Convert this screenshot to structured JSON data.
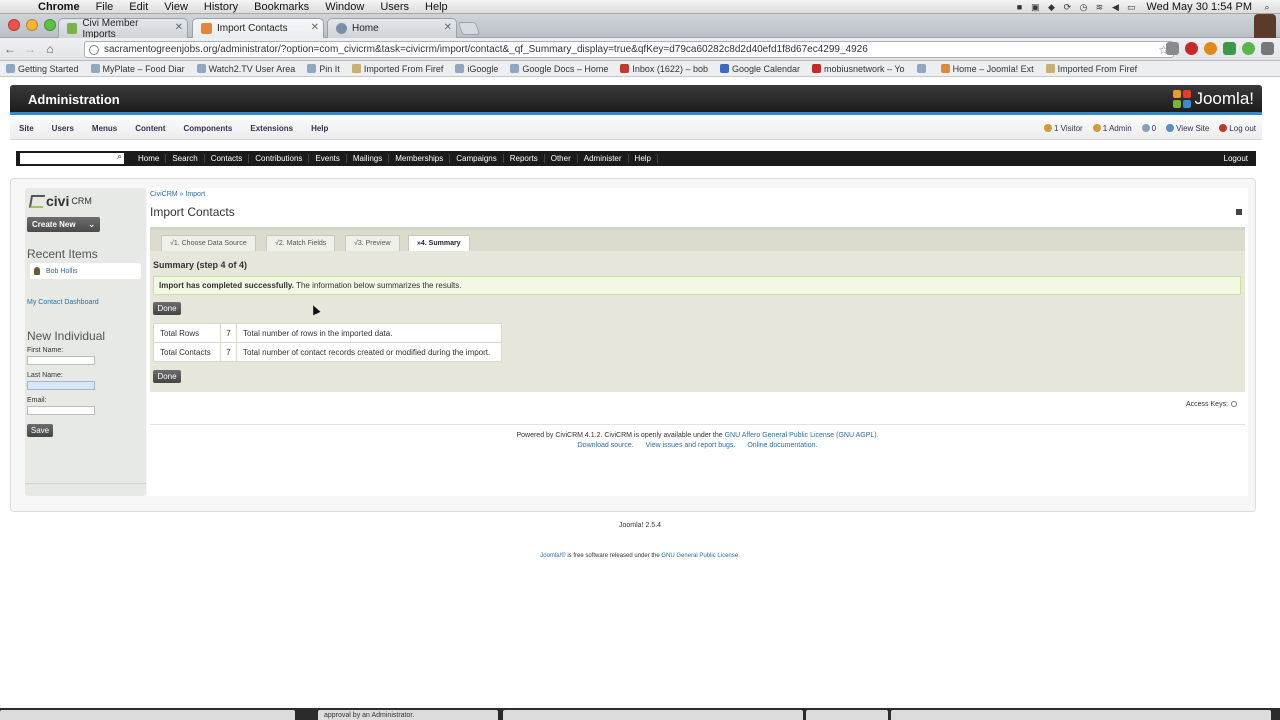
{
  "menubar": {
    "app": "Chrome",
    "items": [
      "File",
      "Edit",
      "View",
      "History",
      "Bookmarks",
      "Window",
      "Users",
      "Help"
    ],
    "clock": "Wed May 30  1:54 PM"
  },
  "tabs": [
    {
      "label": "Civi Member Imports",
      "color": "#7ab24a"
    },
    {
      "label": "Import Contacts",
      "color": "#e2873a"
    },
    {
      "label": "Home",
      "color": "#7a8fa5"
    }
  ],
  "address": {
    "url": "sacramentogreenjobs.org/administrator/?option=com_civicrm&task=civicrm/import/contact&_qf_Summary_display=true&qfKey=d79ca60282c8d2d40efd1f8d67ec4299_4926"
  },
  "bookmarks": [
    "Getting Started",
    "MyPlate – Food Diar",
    "Watch2.TV User Area",
    "Pin It",
    "Imported From Firef",
    "iGoogle",
    "Google Docs – Home",
    "Inbox (1622) – bob",
    "Google Calendar",
    "mobiusnetwork – Yo",
    "",
    "Home – Joomla! Ext",
    "Imported From Firef"
  ],
  "admin": {
    "title": "Administration",
    "logo": "Joomla!"
  },
  "jmenu": {
    "items": [
      "Site",
      "Users",
      "Menus",
      "Content",
      "Components",
      "Extensions",
      "Help"
    ],
    "status": [
      {
        "label": "1 Visitor",
        "color": "#d09b3b"
      },
      {
        "label": "1 Admin",
        "color": "#d09b3b"
      },
      {
        "label": "0",
        "color": "#8aa0b8"
      },
      {
        "label": "View Site",
        "color": "#5a8ec4"
      },
      {
        "label": "Log out",
        "color": "#c0392b"
      }
    ]
  },
  "civinav": {
    "items": [
      "Home",
      "Search",
      "Contacts",
      "Contributions",
      "Events",
      "Mailings",
      "Memberships",
      "Campaigns",
      "Reports",
      "Other",
      "Administer",
      "Help"
    ],
    "logout": "Logout"
  },
  "sidebar": {
    "logo_main": "civi",
    "logo_small": "CRM",
    "create_new": "Create New",
    "recent_heading": "Recent Items",
    "recent_item": "Bob Hollis",
    "dashboard_link": "My Contact Dashboard",
    "new_heading": "New Individual",
    "first_name_label": "First Name:",
    "last_name_label": "Last Name:",
    "email_label": "Email:",
    "save_label": "Save"
  },
  "main": {
    "breadcrumb": "CiviCRM » Import",
    "title": "Import Contacts",
    "steps": [
      "√1. Choose Data Source",
      "√2. Match Fields",
      "√3. Preview",
      "»4. Summary"
    ],
    "summary_heading": "Summary (step 4 of 4)",
    "success_bold": "Import has completed successfully.",
    "success_rest": " The information below summarizes the results.",
    "done_label": "Done",
    "results": [
      {
        "label": "Total Rows",
        "count": "7",
        "desc": "Total number of rows in the imported data."
      },
      {
        "label": "Total Contacts",
        "count": "7",
        "desc": "Total number of contact records created or modified during the import."
      }
    ],
    "access_keys": "Access Keys:"
  },
  "footer": {
    "powered_prefix": "Powered by CiviCRM 4.1.2. CiviCRM is openly available under the ",
    "license_link": "GNU Affero General Public License (GNU AGPL).",
    "download": "Download source.",
    "issues": "View issues and report bugs.",
    "docs": "Online documentation.",
    "joomla_version": "Joomla! 2.5.4",
    "joomla_free_link1": "Joomla!®",
    "joomla_free_mid": " is free software released under the ",
    "joomla_free_link2": "GNU General Public License."
  },
  "dock": {
    "window_text": "approval by an Administrator."
  }
}
